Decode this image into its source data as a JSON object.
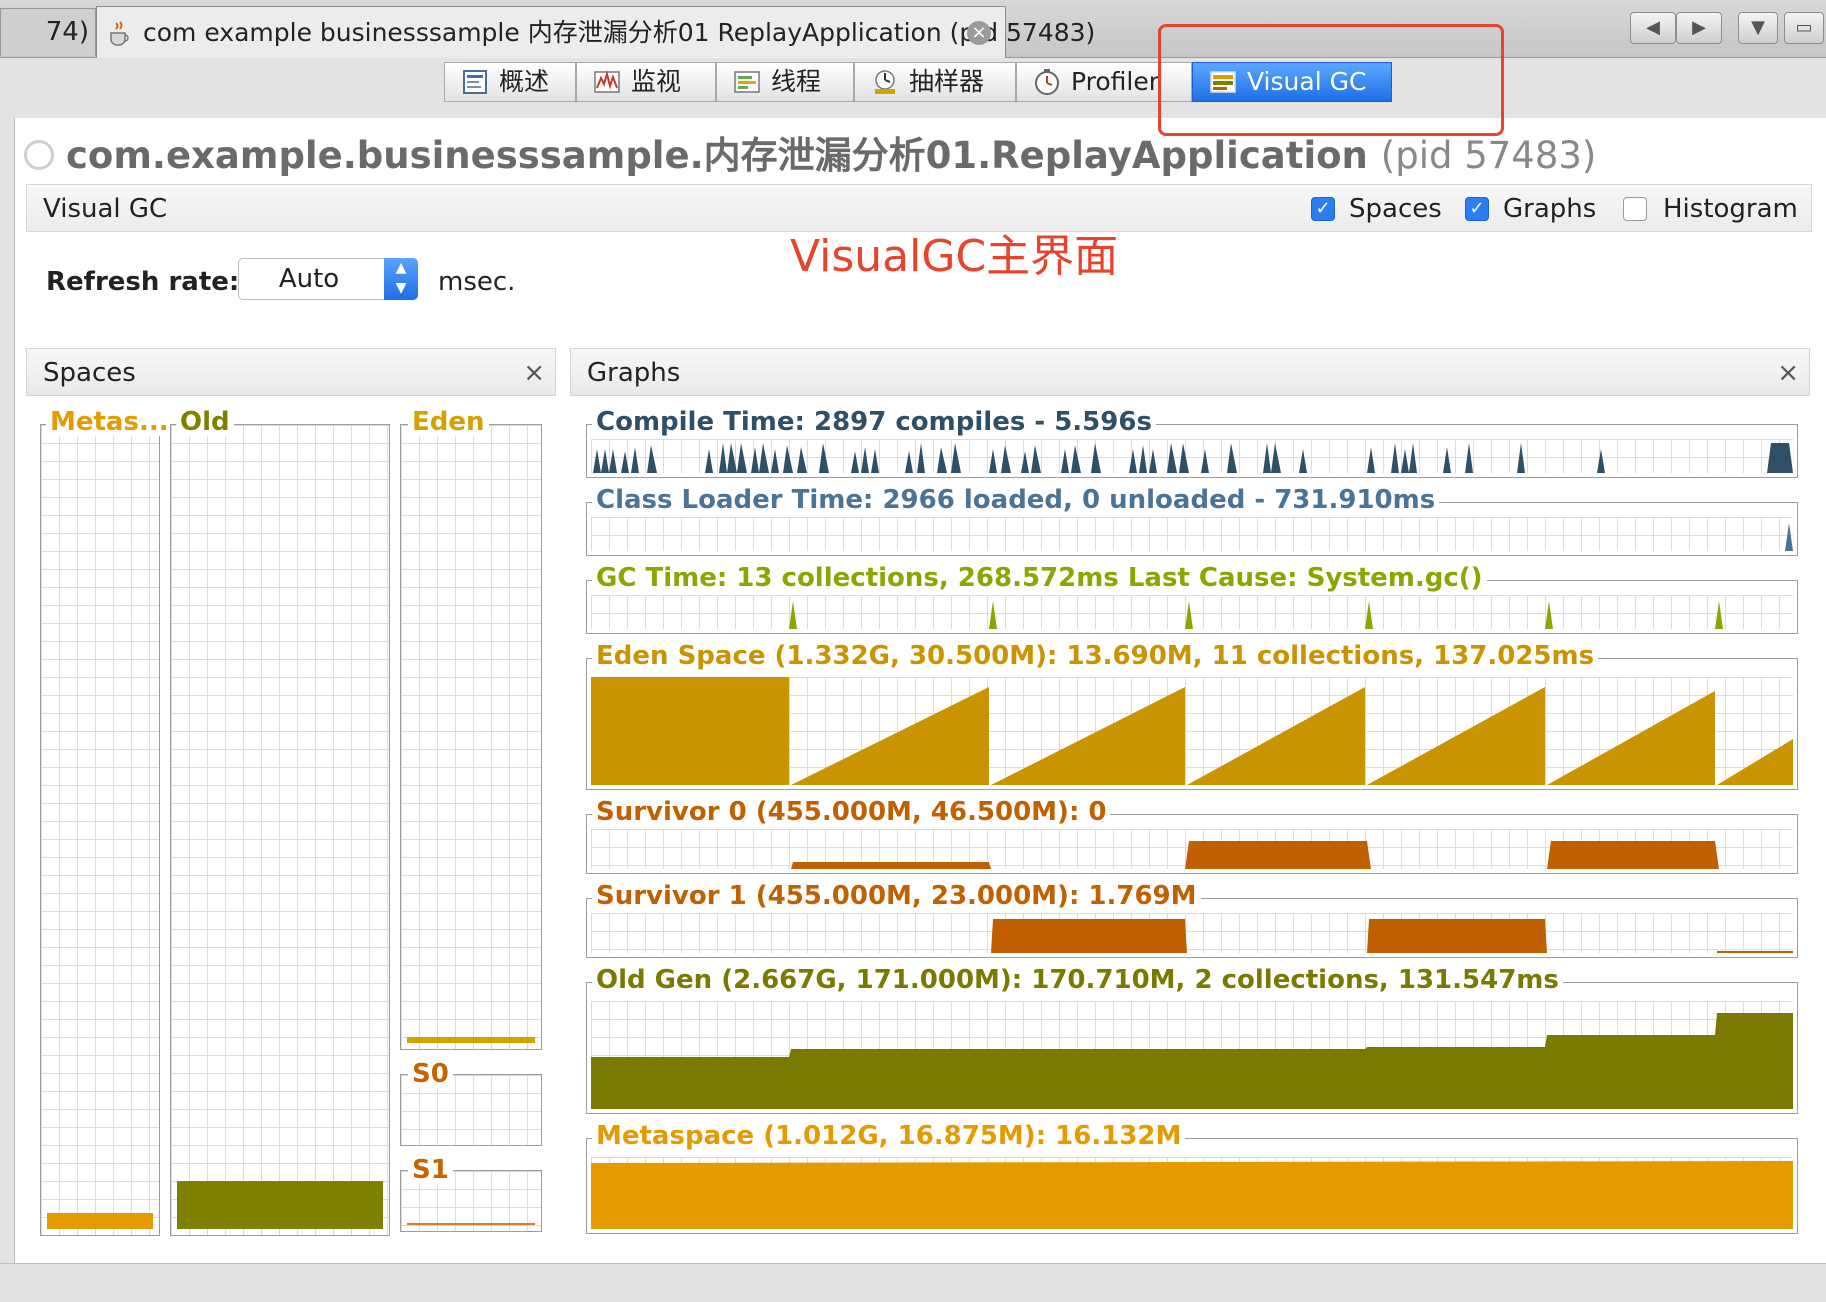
{
  "tabbar": {
    "prev_tab_label": "74)",
    "tab_label": "com example businesssample 内存泄漏分析01 ReplayApplication (pid 57483)",
    "close": "×",
    "nav": [
      "◀",
      "▶",
      "▼",
      "▭"
    ]
  },
  "toolbar": {
    "tabs": [
      {
        "label": "概述",
        "icon": "overview-icon"
      },
      {
        "label": "监视",
        "icon": "monitor-icon"
      },
      {
        "label": "线程",
        "icon": "threads-icon"
      },
      {
        "label": "抽样器",
        "icon": "sampler-icon"
      },
      {
        "label": "Profiler",
        "icon": "profiler-icon"
      },
      {
        "label": "Visual GC",
        "icon": "visualgc-icon",
        "active": true
      }
    ]
  },
  "header": {
    "app_title": "com.example.businesssample.内存泄漏分析01.ReplayApplication",
    "pid": "(pid 57483)"
  },
  "visualgc": {
    "title": "Visual GC",
    "options": [
      {
        "label": "Spaces",
        "checked": true
      },
      {
        "label": "Graphs",
        "checked": true
      },
      {
        "label": "Histogram",
        "checked": false
      }
    ],
    "annotation": "VisualGC主界面",
    "refresh_label": "Refresh rate:",
    "refresh_value": "Auto",
    "refresh_unit": "msec."
  },
  "spaces_panel": {
    "title": "Spaces",
    "close": "×",
    "spaces": [
      {
        "label": "Metas...",
        "fill": 0.02,
        "color": "#e59b00"
      },
      {
        "label": "Old",
        "fill": 0.06,
        "color": "#808000"
      },
      {
        "label": "Eden",
        "fill": 0.01,
        "color": "#d4a100"
      },
      {
        "label": "S0",
        "fill": 0.0,
        "color": "#c86400"
      },
      {
        "label": "S1",
        "fill": 0.04,
        "color": "#e07a20"
      }
    ]
  },
  "graphs_panel": {
    "title": "Graphs",
    "close": "×",
    "graphs": [
      {
        "label": "Compile Time: 2897 compiles - 5.596s",
        "color": "#2e4f66"
      },
      {
        "label": "Class Loader Time: 2966 loaded, 0 unloaded - 731.910ms",
        "color": "#4a7396"
      },
      {
        "label": "GC Time: 13 collections, 268.572ms Last Cause: System.gc()",
        "color": "#8aa600"
      },
      {
        "label": "Eden Space (1.332G, 30.500M): 13.690M, 11 collections, 137.025ms",
        "color": "#c99400"
      },
      {
        "label": "Survivor 0 (455.000M, 46.500M): 0",
        "color": "#c06000"
      },
      {
        "label": "Survivor 1 (455.000M, 23.000M): 1.769M",
        "color": "#c06000"
      },
      {
        "label": "Old Gen (2.667G, 171.000M): 170.710M, 2 collections, 131.547ms",
        "color": "#7a7a00"
      },
      {
        "label": "Metaspace (1.012G, 16.875M): 16.132M",
        "color": "#e59b00"
      }
    ]
  }
}
